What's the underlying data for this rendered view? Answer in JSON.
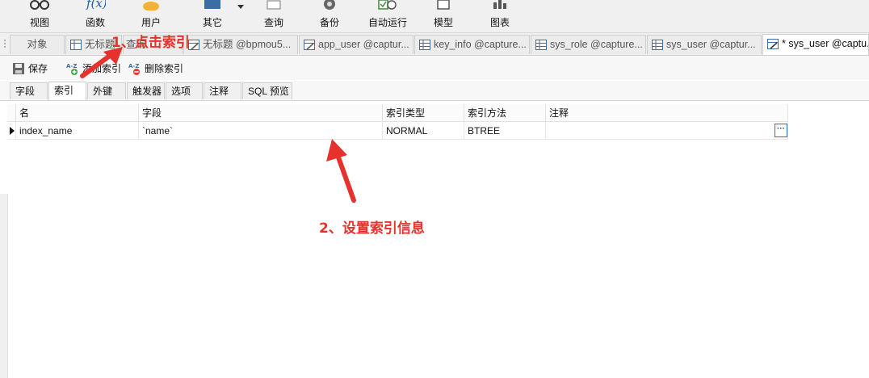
{
  "toolbar": {
    "items": [
      {
        "label": "视图",
        "icon": "glasses-icon"
      },
      {
        "label": "函数",
        "icon": "function-icon"
      },
      {
        "label": "用户",
        "icon": "user-icon"
      },
      {
        "label": "其它",
        "icon": "other-icon"
      },
      {
        "label": "查询",
        "icon": "query-icon"
      },
      {
        "label": "备份",
        "icon": "backup-icon"
      },
      {
        "label": "自动运行",
        "icon": "schedule-icon"
      },
      {
        "label": "模型",
        "icon": "model-icon"
      },
      {
        "label": "图表",
        "icon": "chart-icon"
      }
    ]
  },
  "tabs": {
    "objects": "对象",
    "items": [
      {
        "label": "无标题",
        "active": false
      },
      {
        "label": "查询",
        "active": false
      },
      {
        "label": "无标题 @bpmou5...",
        "active": false
      },
      {
        "label": "app_user @captur...",
        "active": false
      },
      {
        "label": "key_info @capture...",
        "active": false
      },
      {
        "label": "sys_role @capture...",
        "active": false
      },
      {
        "label": "sys_user @captur...",
        "active": false
      },
      {
        "label": "* sys_user @captu...",
        "active": true
      }
    ]
  },
  "editor_toolbar": {
    "save": "保存",
    "add_index": "添加索引",
    "delete_index": "删除索引"
  },
  "subtabs": [
    "字段",
    "索引",
    "外键",
    "触发器",
    "选项",
    "注释",
    "SQL 预览"
  ],
  "grid": {
    "columns": [
      "名",
      "字段",
      "索引类型",
      "索引方法",
      "注释"
    ],
    "rows": [
      {
        "name": "index_name",
        "fields": "`name`",
        "index_type": "NORMAL",
        "index_method": "BTREE",
        "comment": ""
      }
    ],
    "more_button": "···"
  },
  "annotations": {
    "step1": "1、点击索引",
    "step2": "2、设置索引信息"
  },
  "colors": {
    "annotation": "#e5322d",
    "grid_icon": "#3a6ea5",
    "selected_border": "#2f6fc9"
  }
}
